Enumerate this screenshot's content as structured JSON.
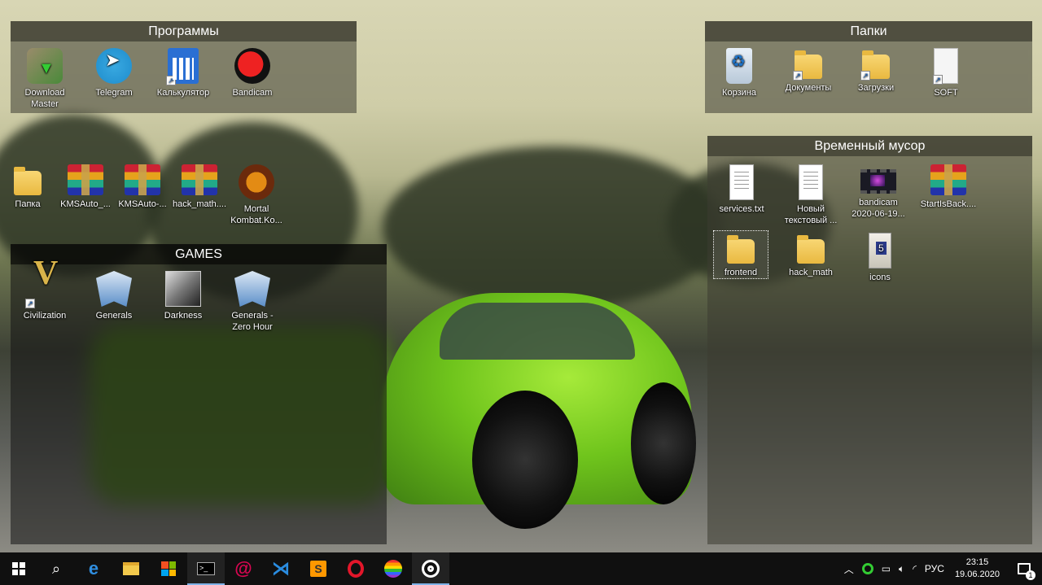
{
  "fences": {
    "programs": {
      "title": "Программы",
      "items": [
        {
          "label": "Download Master",
          "icon": "download-master-icon"
        },
        {
          "label": "Telegram",
          "icon": "telegram-icon"
        },
        {
          "label": "Калькулятор",
          "icon": "calculator-icon"
        },
        {
          "label": "Bandicam",
          "icon": "bandicam-icon"
        }
      ]
    },
    "folders": {
      "title": "Папки",
      "items": [
        {
          "label": "Корзина",
          "icon": "recycle-bin-icon"
        },
        {
          "label": "Документы",
          "icon": "documents-folder-icon"
        },
        {
          "label": "Загрузки",
          "icon": "downloads-folder-icon"
        },
        {
          "label": "SOFT",
          "icon": "soft-folder-icon"
        }
      ]
    },
    "trash": {
      "title": "Временный мусор",
      "items": [
        {
          "label": "services.txt",
          "icon": "text-file-icon"
        },
        {
          "label": "Новый текстовый ...",
          "icon": "text-file-icon"
        },
        {
          "label": "bandicam 2020-06-19...",
          "icon": "video-file-icon"
        },
        {
          "label": "StartIsBack....",
          "icon": "winrar-archive-icon"
        },
        {
          "label": "frontend",
          "icon": "folder-icon"
        },
        {
          "label": "hack_math",
          "icon": "folder-icon"
        },
        {
          "label": "icons",
          "icon": "icons-folder-icon"
        }
      ]
    },
    "games": {
      "title": "GAMES",
      "items": [
        {
          "label": "Civilization",
          "icon": "civilization-icon"
        },
        {
          "label": "Generals",
          "icon": "generals-icon"
        },
        {
          "label": "Darkness",
          "icon": "darkness-icon"
        },
        {
          "label": "Generals - Zero Hour",
          "icon": "generals-zero-hour-icon"
        }
      ]
    }
  },
  "desktop": {
    "items": [
      {
        "label": "Папка",
        "icon": "folder-icon"
      },
      {
        "label": "KMSAuto_...",
        "icon": "winrar-archive-icon"
      },
      {
        "label": "KMSAuto-...",
        "icon": "winrar-archive-icon"
      },
      {
        "label": "hack_math....",
        "icon": "winrar-archive-icon"
      },
      {
        "label": "Mortal Kombat.Ko...",
        "icon": "mortal-kombat-icon"
      }
    ]
  },
  "taskbar": {
    "apps": [
      {
        "name": "start-button",
        "icon": "windows-icon"
      },
      {
        "name": "search-button",
        "icon": "search-icon"
      },
      {
        "name": "edge",
        "icon": "edge-icon"
      },
      {
        "name": "file-explorer",
        "icon": "file-explorer-icon"
      },
      {
        "name": "store",
        "icon": "store-icon"
      },
      {
        "name": "terminal",
        "icon": "terminal-icon"
      },
      {
        "name": "debian",
        "icon": "debian-icon"
      },
      {
        "name": "vscode",
        "icon": "vscode-icon"
      },
      {
        "name": "sublime",
        "icon": "sublime-icon"
      },
      {
        "name": "opera",
        "icon": "opera-icon"
      },
      {
        "name": "lgbt-app",
        "icon": "rainbow-icon"
      },
      {
        "name": "obs",
        "icon": "obs-icon"
      }
    ],
    "tray": {
      "language": "РУС",
      "time": "23:15",
      "date": "19.06.2020",
      "notifications_count": "1"
    }
  }
}
